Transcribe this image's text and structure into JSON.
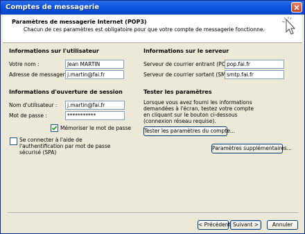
{
  "window": {
    "title": "Comptes de messagerie"
  },
  "header": {
    "title": "Paramètres de messagerie Internet (POP3)",
    "subtitle": "Chacun de ces paramètres est obligatoire pour que votre compte de messagerie fonctionne."
  },
  "user_info": {
    "heading": "Informations sur l'utilisateur",
    "name_label": "Votre nom :",
    "name_value": "Jean MARTIN",
    "email_label": "Adresse de messagerie :",
    "email_value": "j.martin@fai.fr"
  },
  "server_info": {
    "heading": "Informations sur le serveur",
    "incoming_label": "Serveur de courrier entrant (POP3) :",
    "incoming_value": "pop.fai.fr",
    "outgoing_label": "Serveur de courrier sortant (SMTP) :",
    "outgoing_value": "smtp.fai.fr"
  },
  "logon_info": {
    "heading": "Informations d'ouverture de session",
    "username_label": "Nom d'utilisateur :",
    "username_value": "j.martin@fai.fr",
    "password_label": "Mot de passe :",
    "password_value": "***********",
    "remember_label": "Mémoriser le mot de passe",
    "remember_checked": true,
    "spa_label_line1": "Se connecter à l'aide de",
    "spa_label_line2": "l'authentification par mot de passe",
    "spa_label_line3": "sécurisé (SPA)",
    "spa_checked": false
  },
  "test_settings": {
    "heading": "Tester les paramètres",
    "description": "Lorsque vous avez fourni les informations demandées à l'écran, testez votre compte en cliquant sur le bouton ci-dessous (connexion réseau requise).",
    "test_button": "Tester les paramètres du compte...",
    "more_button": "Paramètres supplémentaires..."
  },
  "footer": {
    "prev_button": "< Précédent",
    "next_button": "Suivant >",
    "cancel_button": "Annuler"
  },
  "colors": {
    "titlebar": "#0a54e0",
    "dialog_bg": "#ece9d8",
    "field_border": "#7f9db9"
  }
}
